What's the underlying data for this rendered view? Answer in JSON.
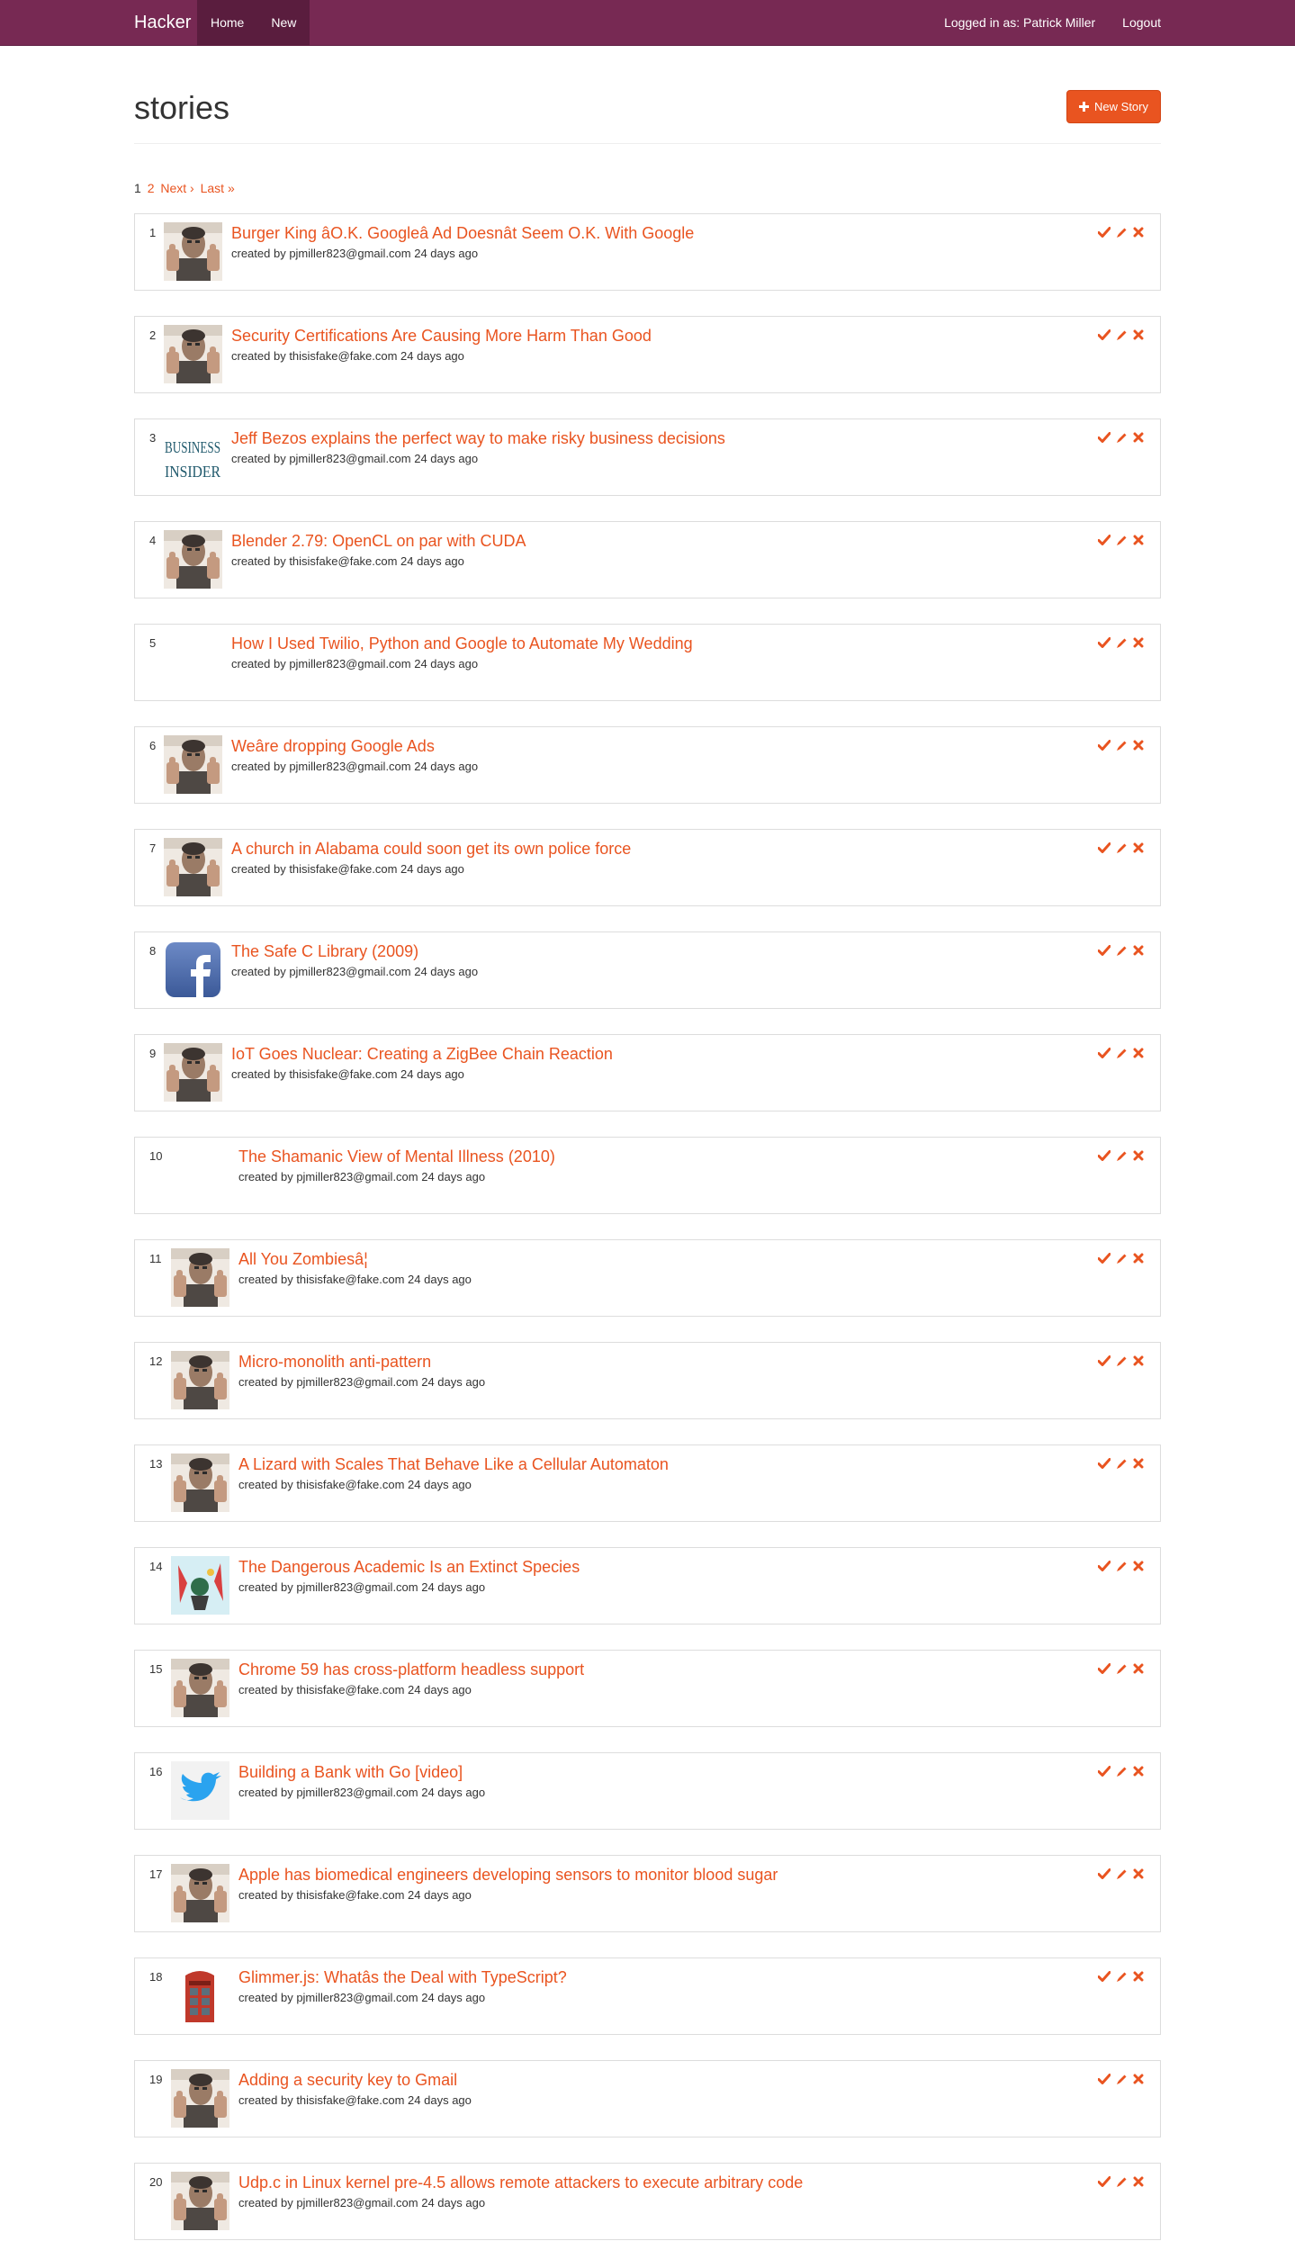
{
  "navbar": {
    "brand": "Hacker",
    "links": [
      "Home",
      "New"
    ],
    "logged_in": "Logged in as: Patrick Miller",
    "logout": "Logout"
  },
  "header": {
    "title": "stories",
    "new_story": "New Story"
  },
  "pagination": {
    "current": "1",
    "next_page": "2",
    "next": "Next ›",
    "last": "Last »"
  },
  "colors": {
    "navbar": "#772953",
    "accent": "#e95420"
  },
  "stories": [
    {
      "rank": "1",
      "title": "Burger King âO.K. Googleâ Ad Doesnât Seem O.K. With Google",
      "meta": "created by pjmiller823@gmail.com 24 days ago",
      "thumb": "thumbs-up-man"
    },
    {
      "rank": "2",
      "title": "Security Certifications Are Causing More Harm Than Good",
      "meta": "created by thisisfake@fake.com 24 days ago",
      "thumb": "thumbs-up-man"
    },
    {
      "rank": "3",
      "title": "Jeff Bezos explains the perfect way to make risky business decisions",
      "meta": "created by pjmiller823@gmail.com 24 days ago",
      "thumb": "business-insider",
      "thumb_text": [
        "BUSINESS",
        "INSIDER"
      ]
    },
    {
      "rank": "4",
      "title": "Blender 2.79: OpenCL on par with CUDA",
      "meta": "created by thisisfake@fake.com 24 days ago",
      "thumb": "thumbs-up-man"
    },
    {
      "rank": "5",
      "title": "How I Used Twilio, Python and Google to Automate My Wedding",
      "meta": "created by pjmiller823@gmail.com 24 days ago",
      "thumb": "none"
    },
    {
      "rank": "6",
      "title": "Weâre dropping Google Ads",
      "meta": "created by pjmiller823@gmail.com 24 days ago",
      "thumb": "thumbs-up-man"
    },
    {
      "rank": "7",
      "title": "A church in Alabama could soon get its own police force",
      "meta": "created by thisisfake@fake.com 24 days ago",
      "thumb": "thumbs-up-man"
    },
    {
      "rank": "8",
      "title": "The Safe C Library (2009)",
      "meta": "created by pjmiller823@gmail.com 24 days ago",
      "thumb": "facebook"
    },
    {
      "rank": "9",
      "title": "IoT Goes Nuclear: Creating a ZigBee Chain Reaction",
      "meta": "created by thisisfake@fake.com 24 days ago",
      "thumb": "thumbs-up-man"
    },
    {
      "rank": "10",
      "title": "The Shamanic View of Mental Illness (2010)",
      "meta": "created by pjmiller823@gmail.com 24 days ago",
      "thumb": "none"
    },
    {
      "rank": "11",
      "title": "All You Zombiesâ¦",
      "meta": "created by thisisfake@fake.com 24 days ago",
      "thumb": "thumbs-up-man"
    },
    {
      "rank": "12",
      "title": "Micro-monolith anti-pattern",
      "meta": "created by pjmiller823@gmail.com 24 days ago",
      "thumb": "thumbs-up-man"
    },
    {
      "rank": "13",
      "title": "A Lizard with Scales That Behave Like a Cellular Automaton",
      "meta": "created by thisisfake@fake.com 24 days ago",
      "thumb": "thumbs-up-man"
    },
    {
      "rank": "14",
      "title": "The Dangerous Academic Is an Extinct Species",
      "meta": "created by pjmiller823@gmail.com 24 days ago",
      "thumb": "illustration"
    },
    {
      "rank": "15",
      "title": "Chrome 59 has cross-platform headless support",
      "meta": "created by thisisfake@fake.com 24 days ago",
      "thumb": "thumbs-up-man"
    },
    {
      "rank": "16",
      "title": "Building a Bank with Go [video]",
      "meta": "created by pjmiller823@gmail.com 24 days ago",
      "thumb": "twitter"
    },
    {
      "rank": "17",
      "title": "Apple has biomedical engineers developing sensors to monitor blood sugar",
      "meta": "created by thisisfake@fake.com 24 days ago",
      "thumb": "thumbs-up-man"
    },
    {
      "rank": "18",
      "title": "Glimmer.js: Whatâs the Deal with TypeScript?",
      "meta": "created by pjmiller823@gmail.com 24 days ago",
      "thumb": "phone-booth"
    },
    {
      "rank": "19",
      "title": "Adding a security key to Gmail",
      "meta": "created by thisisfake@fake.com 24 days ago",
      "thumb": "thumbs-up-man"
    },
    {
      "rank": "20",
      "title": "Udp.c in Linux kernel pre-4.5 allows remote attackers to execute arbitrary code",
      "meta": "created by pjmiller823@gmail.com 24 days ago",
      "thumb": "thumbs-up-man"
    }
  ]
}
